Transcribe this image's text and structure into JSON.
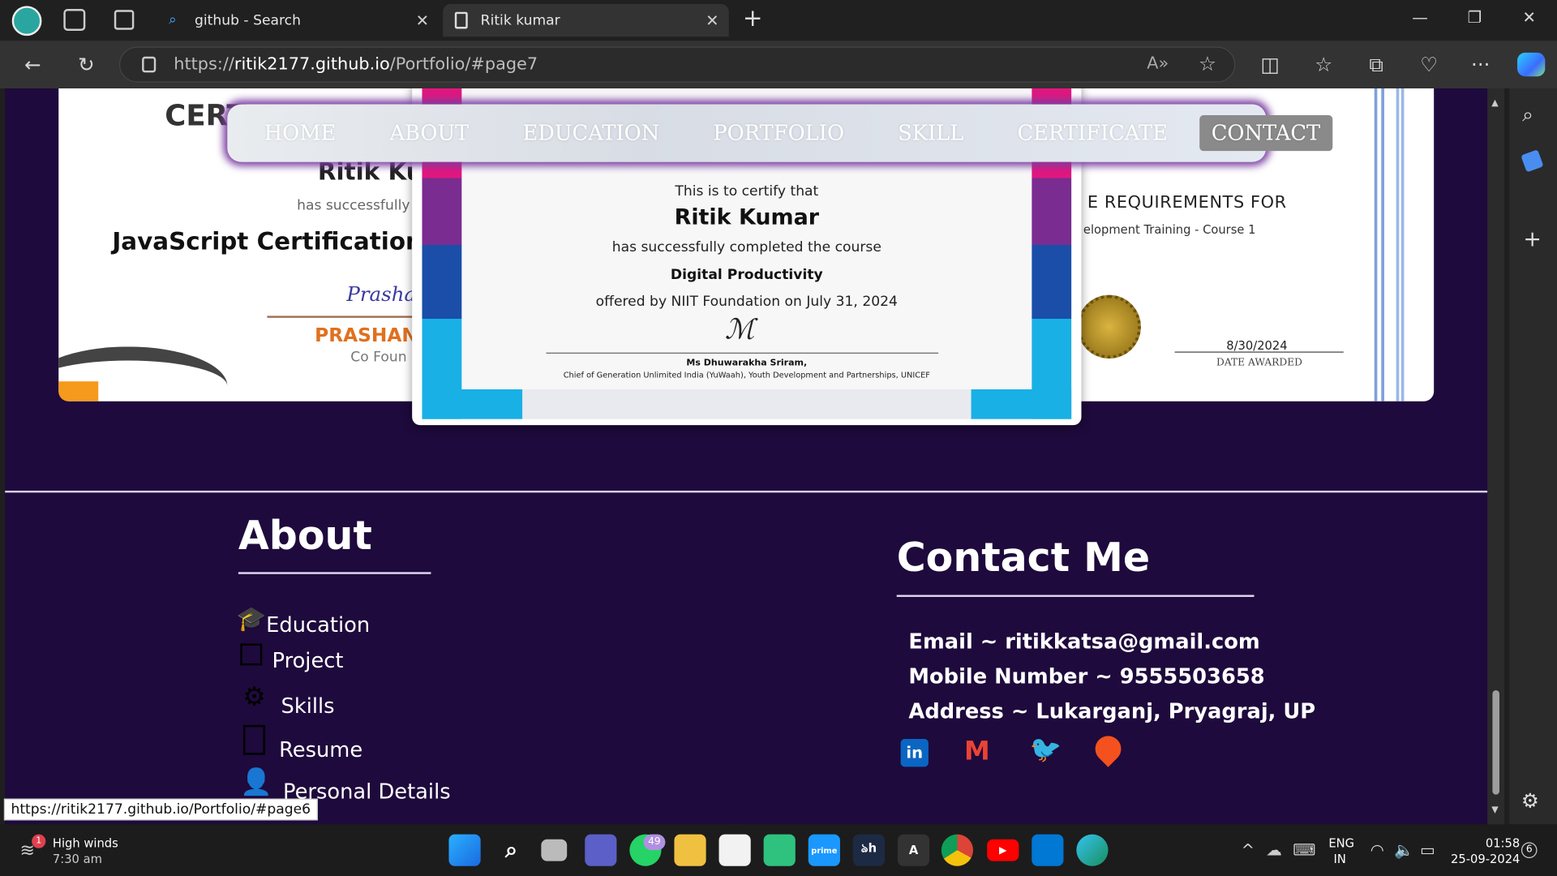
{
  "browser": {
    "tabs": [
      {
        "title": "github - Search"
      },
      {
        "title": "Ritik kumar"
      }
    ],
    "url": {
      "prefix": "https://",
      "domain": "ritik2177.github.io",
      "path": "/Portfolio/#page7"
    }
  },
  "nav": {
    "items": [
      "HOME",
      "ABOUT",
      "EDUCATION",
      "PORTFOLIO",
      "SKILL",
      "CERTIFICATE",
      "CONTACT"
    ],
    "active": "CONTACT"
  },
  "cert_left": {
    "heading": "CERT",
    "name": "Ritik Ku",
    "line": "has successfully",
    "course": "JavaScript Certification T",
    "signer": "PRASHAN",
    "role": "Co Foun"
  },
  "cert_center": {
    "l1": "This is to certify that",
    "name": "Ritik Kumar",
    "l2": "has successfully completed the course",
    "course": "Digital Productivity",
    "l3": "offered by NIIT Foundation on July 31, 2024",
    "signer": "Ms Dhuwarakha Sriram,",
    "role": "Chief of Generation Unlimited India (YuWaah), Youth Development and Partnerships, UNICEF"
  },
  "cert_right": {
    "l1": "E REQUIREMENTS FOR",
    "l2": "elopment Training - Course 1",
    "date": "8/30/2024",
    "date_label": "DATE AWARDED"
  },
  "about": {
    "title": "About",
    "links": [
      "Education",
      "Project",
      "Skills",
      "Resume",
      "Personal Details"
    ]
  },
  "contact": {
    "title": "Contact Me",
    "email": "Email ~ ritikkatsa@gmail.com",
    "mobile": "Mobile Number ~ 9555503658",
    "address": "Address ~ Lukarganj, Pryagraj, UP"
  },
  "status_url": "https://ritik2177.github.io/Portfolio/#page6",
  "taskbar": {
    "weather_title": "High winds",
    "weather_time": "7:30 am",
    "weather_badge": "1",
    "whatsapp_badge": "49",
    "lang1": "ENG",
    "lang2": "IN",
    "time": "01:58",
    "date": "25-09-2024",
    "notif": "6"
  },
  "colors": {
    "page_bg": "#1e0a3c",
    "accent_glow": "#7a3ea0"
  }
}
